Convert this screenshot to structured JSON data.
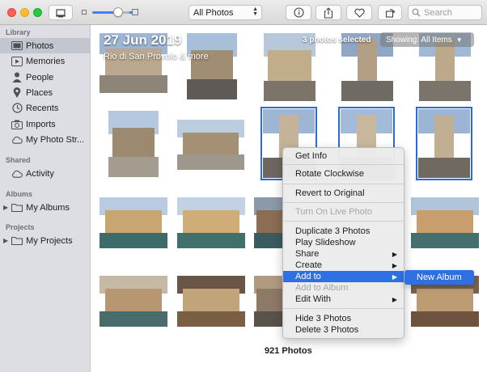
{
  "toolbar": {
    "view_dropdown": "All Photos",
    "search_placeholder": "Search"
  },
  "sidebar": {
    "sections": {
      "library": "Library",
      "shared": "Shared",
      "albums": "Albums",
      "projects": "Projects"
    },
    "items": [
      {
        "label": "Photos",
        "icon": "photos-icon"
      },
      {
        "label": "Memories",
        "icon": "memories-icon"
      },
      {
        "label": "People",
        "icon": "people-icon"
      },
      {
        "label": "Places",
        "icon": "places-icon"
      },
      {
        "label": "Recents",
        "icon": "clock-icon"
      },
      {
        "label": "Imports",
        "icon": "imports-icon"
      },
      {
        "label": "My Photo Str...",
        "icon": "cloud-icon"
      },
      {
        "label": "Activity",
        "icon": "cloud-icon"
      },
      {
        "label": "My Albums",
        "icon": "folder-icon"
      },
      {
        "label": "My Projects",
        "icon": "folder-icon"
      }
    ]
  },
  "main": {
    "date": "27 Jun 2019",
    "location": "Rio di San Provolo & more",
    "selection": "3 photos selected",
    "showing": "Showing: All Items",
    "photo_count": "921 Photos"
  },
  "context_menu": {
    "items": [
      "Get Info",
      "Rotate Clockwise",
      "Revert to Original",
      "Turn On Live Photo",
      "Duplicate 3 Photos",
      "Play Slideshow",
      "Share",
      "Create",
      "Add to",
      "Add to Album",
      "Edit With",
      "Hide 3 Photos",
      "Delete 3 Photos"
    ],
    "submenu_item": "New Album"
  },
  "colors": {
    "accent": "#2f6fe4",
    "sidebar_bg": "#dcdee3",
    "selection_outline": "#2a6bd6"
  }
}
